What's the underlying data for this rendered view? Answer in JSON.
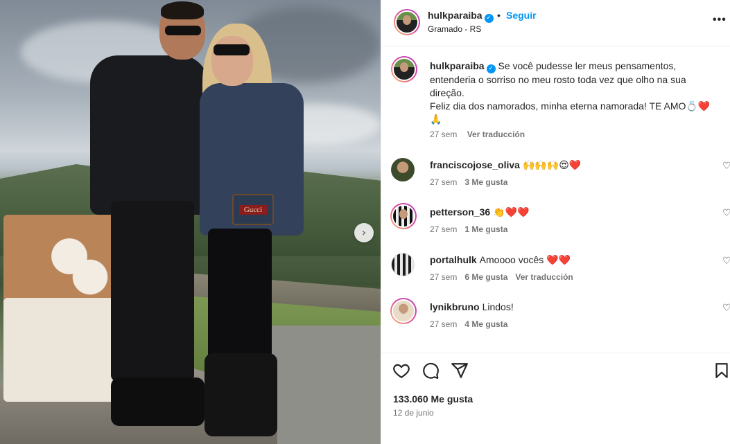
{
  "post": {
    "username": "hulkparaiba",
    "dot": "•",
    "follow_label": "Seguir",
    "location": "Gramado - RS",
    "more_label": "•••",
    "caption": "Se você pudesse ler meus pensamentos, entenderia o sorriso no meu rosto toda vez que olho na sua direção.",
    "caption_line2": "Feliz dia dos namorados, minha eterna namorada! TE AMO💍❤️",
    "caption_line3": "🙏",
    "caption_age": "27 sem",
    "translate_label": "Ver traducción",
    "likes": "133.060 Me gusta",
    "date": "12 de junio"
  },
  "photo": {
    "next_label": "›",
    "bag_text": "Gucci"
  },
  "comments": [
    {
      "user": "franciscojose_oliva",
      "text": "🙌🙌🙌😍❤️",
      "age": "27 sem",
      "likes": "3 Me gusta",
      "translate": ""
    },
    {
      "user": "petterson_36",
      "text": "👏❤️❤️",
      "age": "27 sem",
      "likes": "1 Me gusta",
      "translate": ""
    },
    {
      "user": "portalhulk",
      "text": "Amoooo vocês ❤️❤️",
      "age": "27 sem",
      "likes": "6 Me gusta",
      "translate": "Ver traducción"
    },
    {
      "user": "lynikbruno",
      "text": "Lindos!",
      "age": "27 sem",
      "likes": "4 Me gusta",
      "translate": ""
    }
  ],
  "icons": {
    "verified": "✓",
    "heart": "♡"
  },
  "colors": {
    "accent": "#0095f6",
    "text": "#262626",
    "muted": "#737373"
  }
}
